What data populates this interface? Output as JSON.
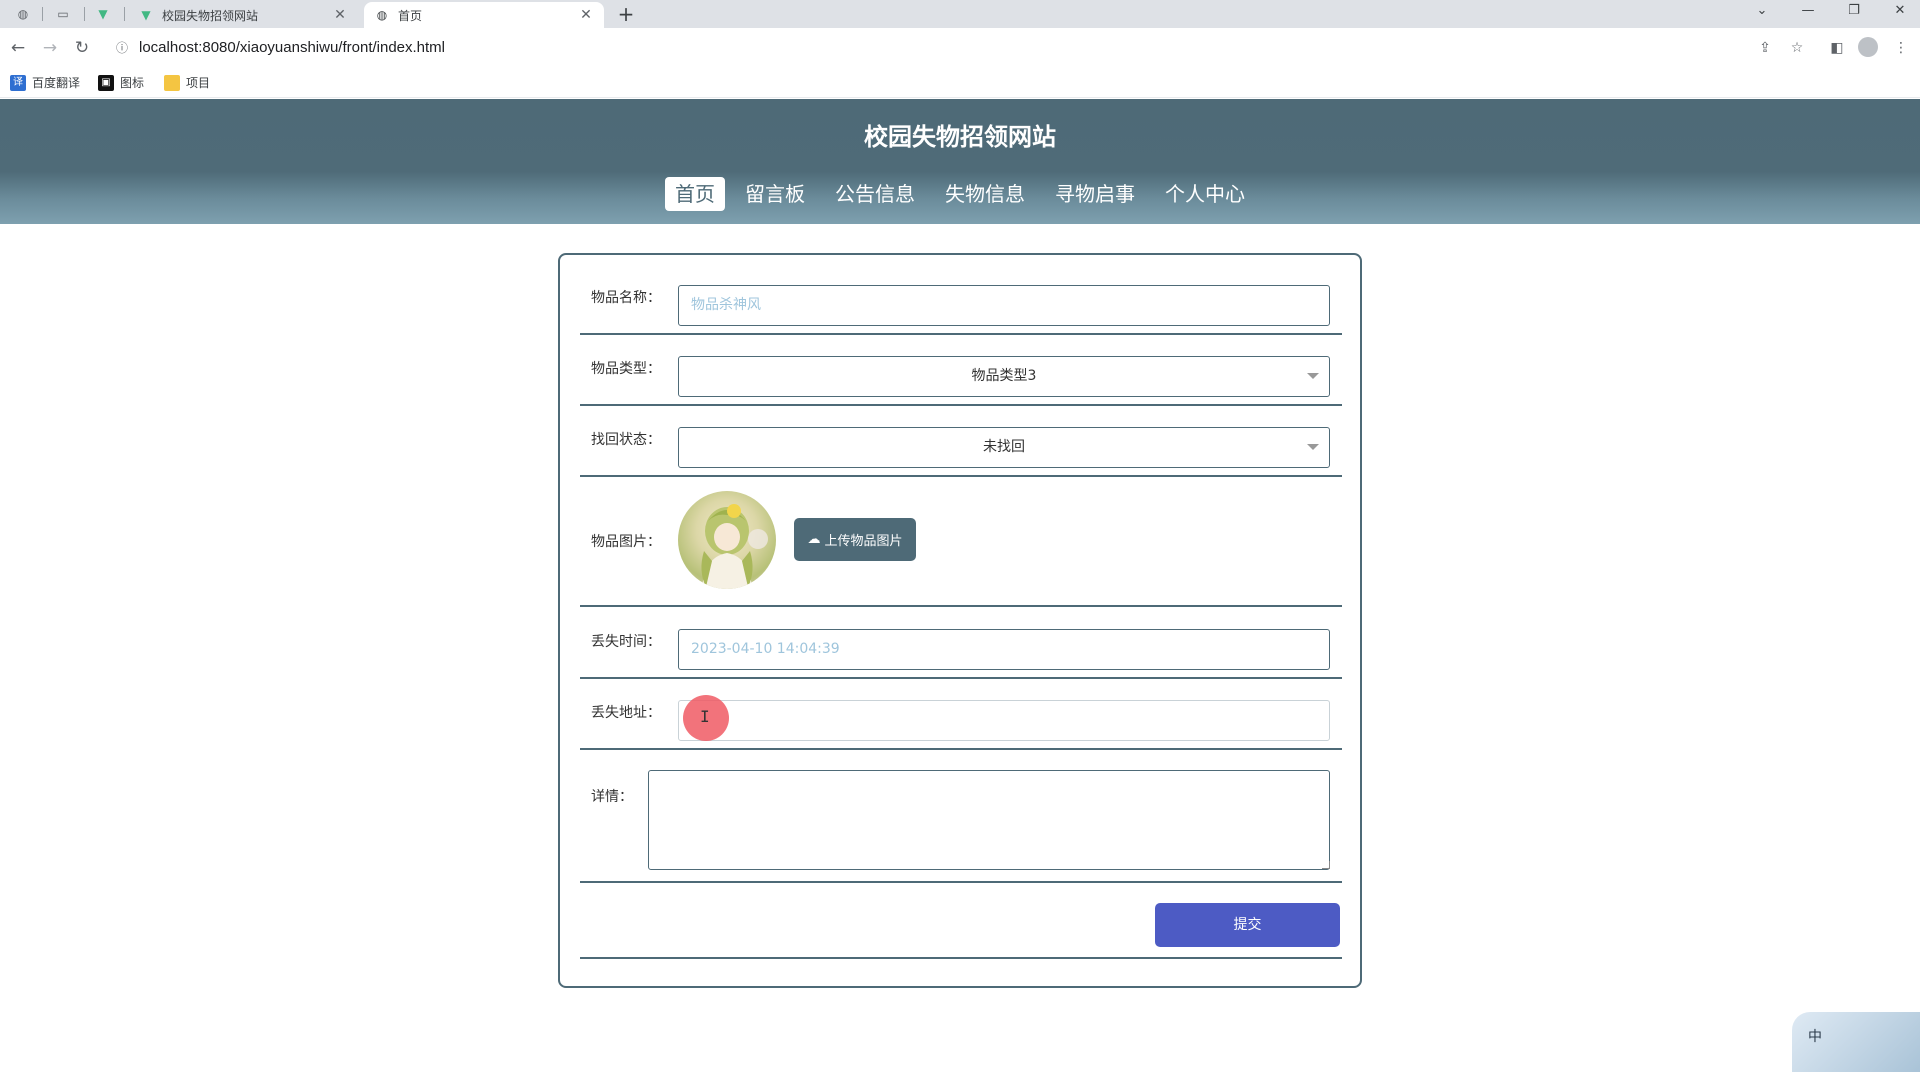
{
  "browser": {
    "tabs": [
      {
        "title": "校园失物招领网站",
        "active": false
      },
      {
        "title": "首页",
        "active": true
      }
    ],
    "new_tab_label": "+",
    "url": "localhost:8080/xiaoyuanshiwu/front/index.html",
    "bookmarks": [
      {
        "label": "百度翻译",
        "icon_text": "译",
        "color": "#2f6fd1"
      },
      {
        "label": "图标",
        "icon_text": "▣",
        "color": "#111111"
      },
      {
        "label": "项目",
        "icon_text": "",
        "color": "#f4c542"
      }
    ]
  },
  "site": {
    "title": "校园失物招领网站",
    "nav": [
      {
        "label": "首页",
        "active": true
      },
      {
        "label": "留言板",
        "active": false
      },
      {
        "label": "公告信息",
        "active": false
      },
      {
        "label": "失物信息",
        "active": false
      },
      {
        "label": "寻物启事",
        "active": false
      },
      {
        "label": "个人中心",
        "active": false
      }
    ]
  },
  "form": {
    "item_name": {
      "label": "物品名称：",
      "value": "物品杀神风"
    },
    "item_type": {
      "label": "物品类型：",
      "value": "物品类型3"
    },
    "found_status": {
      "label": "找回状态：",
      "value": "未找回"
    },
    "item_image": {
      "label": "物品图片：",
      "upload_label": "上传物品图片"
    },
    "lost_time": {
      "label": "丢失时间：",
      "value": "2023-04-10 14:04:39"
    },
    "lost_address": {
      "label": "丢失地址：",
      "value": ""
    },
    "details": {
      "label": "详情：",
      "value": ""
    },
    "submit_label": "提交"
  },
  "ime": {
    "label": "中"
  },
  "colors": {
    "header": "#4e6a77",
    "submit": "#4d5bc4",
    "placeholder_text": "#9fc5dc"
  }
}
